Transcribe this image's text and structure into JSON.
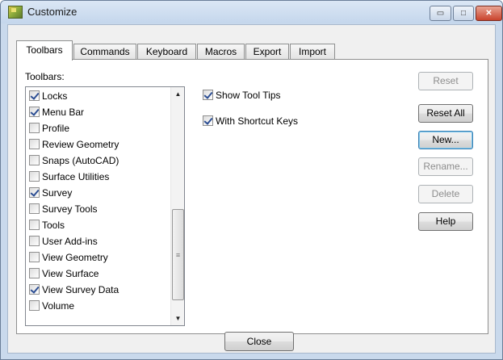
{
  "window": {
    "title": "Customize",
    "icon": "app-icon",
    "controls": {
      "minimize": "▭",
      "maximize": "□",
      "close": "✕"
    }
  },
  "tabs": [
    {
      "label": "Toolbars",
      "active": true
    },
    {
      "label": "Commands"
    },
    {
      "label": "Keyboard"
    },
    {
      "label": "Macros"
    },
    {
      "label": "Export"
    },
    {
      "label": "Import"
    }
  ],
  "toolbars_panel": {
    "list_label": "Toolbars:",
    "items": [
      {
        "label": "Locks",
        "checked": true
      },
      {
        "label": "Menu Bar",
        "checked": true
      },
      {
        "label": "Profile",
        "checked": false
      },
      {
        "label": "Review Geometry",
        "checked": false
      },
      {
        "label": "Snaps (AutoCAD)",
        "checked": false
      },
      {
        "label": "Surface Utilities",
        "checked": false
      },
      {
        "label": "Survey",
        "checked": true
      },
      {
        "label": "Survey Tools",
        "checked": false
      },
      {
        "label": "Tools",
        "checked": false
      },
      {
        "label": "User Add-ins",
        "checked": false
      },
      {
        "label": "View Geometry",
        "checked": false
      },
      {
        "label": "View Surface",
        "checked": false
      },
      {
        "label": "View Survey Data",
        "checked": true
      },
      {
        "label": "Volume",
        "checked": false
      }
    ],
    "options": {
      "show_tool_tips": {
        "label": "Show Tool Tips",
        "checked": true
      },
      "with_shortcut_keys": {
        "label": "With Shortcut Keys",
        "checked": true
      }
    },
    "buttons": {
      "reset": "Reset",
      "reset_all": "Reset All",
      "new": "New...",
      "rename": "Rename...",
      "delete": "Delete",
      "help": "Help"
    }
  },
  "footer": {
    "close_label": "Close"
  },
  "colors": {
    "accent": "#2c4e93",
    "title_bar": "#c4d6ec",
    "close_button": "#c9432d"
  }
}
